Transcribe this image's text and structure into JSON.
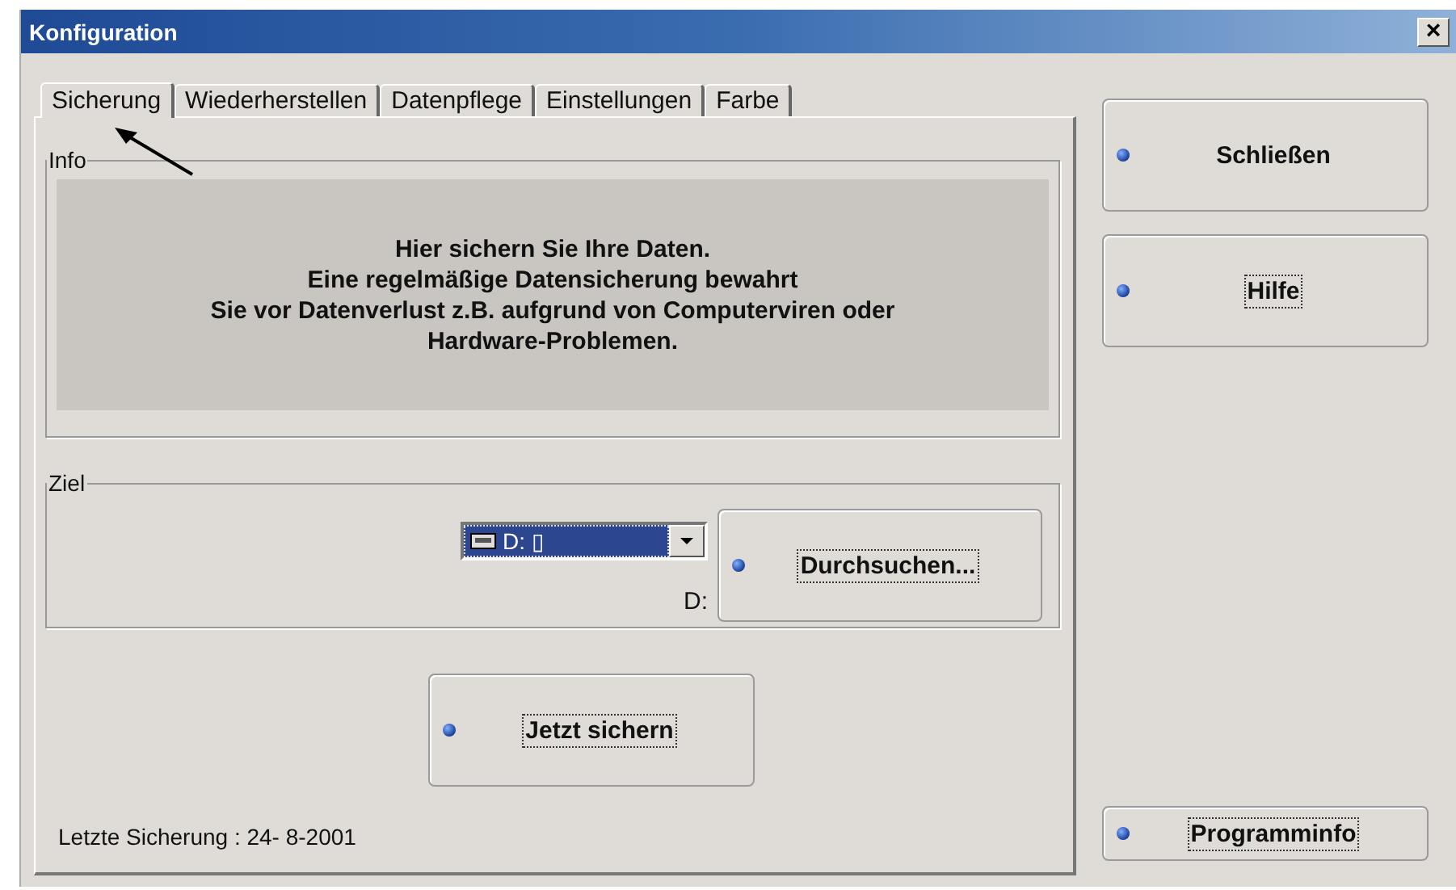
{
  "window": {
    "title": "Konfiguration",
    "close": "×"
  },
  "tabs": [
    {
      "label": "Sicherung",
      "selected": true
    },
    {
      "label": "Wiederherstellen",
      "selected": false
    },
    {
      "label": "Datenpflege",
      "selected": false
    },
    {
      "label": "Einstellungen",
      "selected": false
    },
    {
      "label": "Farbe",
      "selected": false
    }
  ],
  "info": {
    "legend": "Info",
    "lines": [
      "Hier sichern Sie Ihre Daten.",
      "Eine regelmäßige Datensicherung bewahrt",
      "Sie vor Datenverlust z.B. aufgrund von Computerviren oder",
      "Hardware-Problemen."
    ]
  },
  "ziel": {
    "legend": "Ziel",
    "drive": "D: ▯",
    "path": "D:",
    "browse": {
      "label": "Durchsuchen...",
      "focused": true
    }
  },
  "backup_button": {
    "label": "Jetzt sichern",
    "focused": true
  },
  "last_backup": "Letzte Sicherung : 24- 8-2001",
  "side_buttons": [
    {
      "label": "Schließen",
      "focused": false
    },
    {
      "label": "Hilfe",
      "focused": true
    }
  ],
  "info_button": {
    "label": "Programminfo",
    "focused": true
  }
}
